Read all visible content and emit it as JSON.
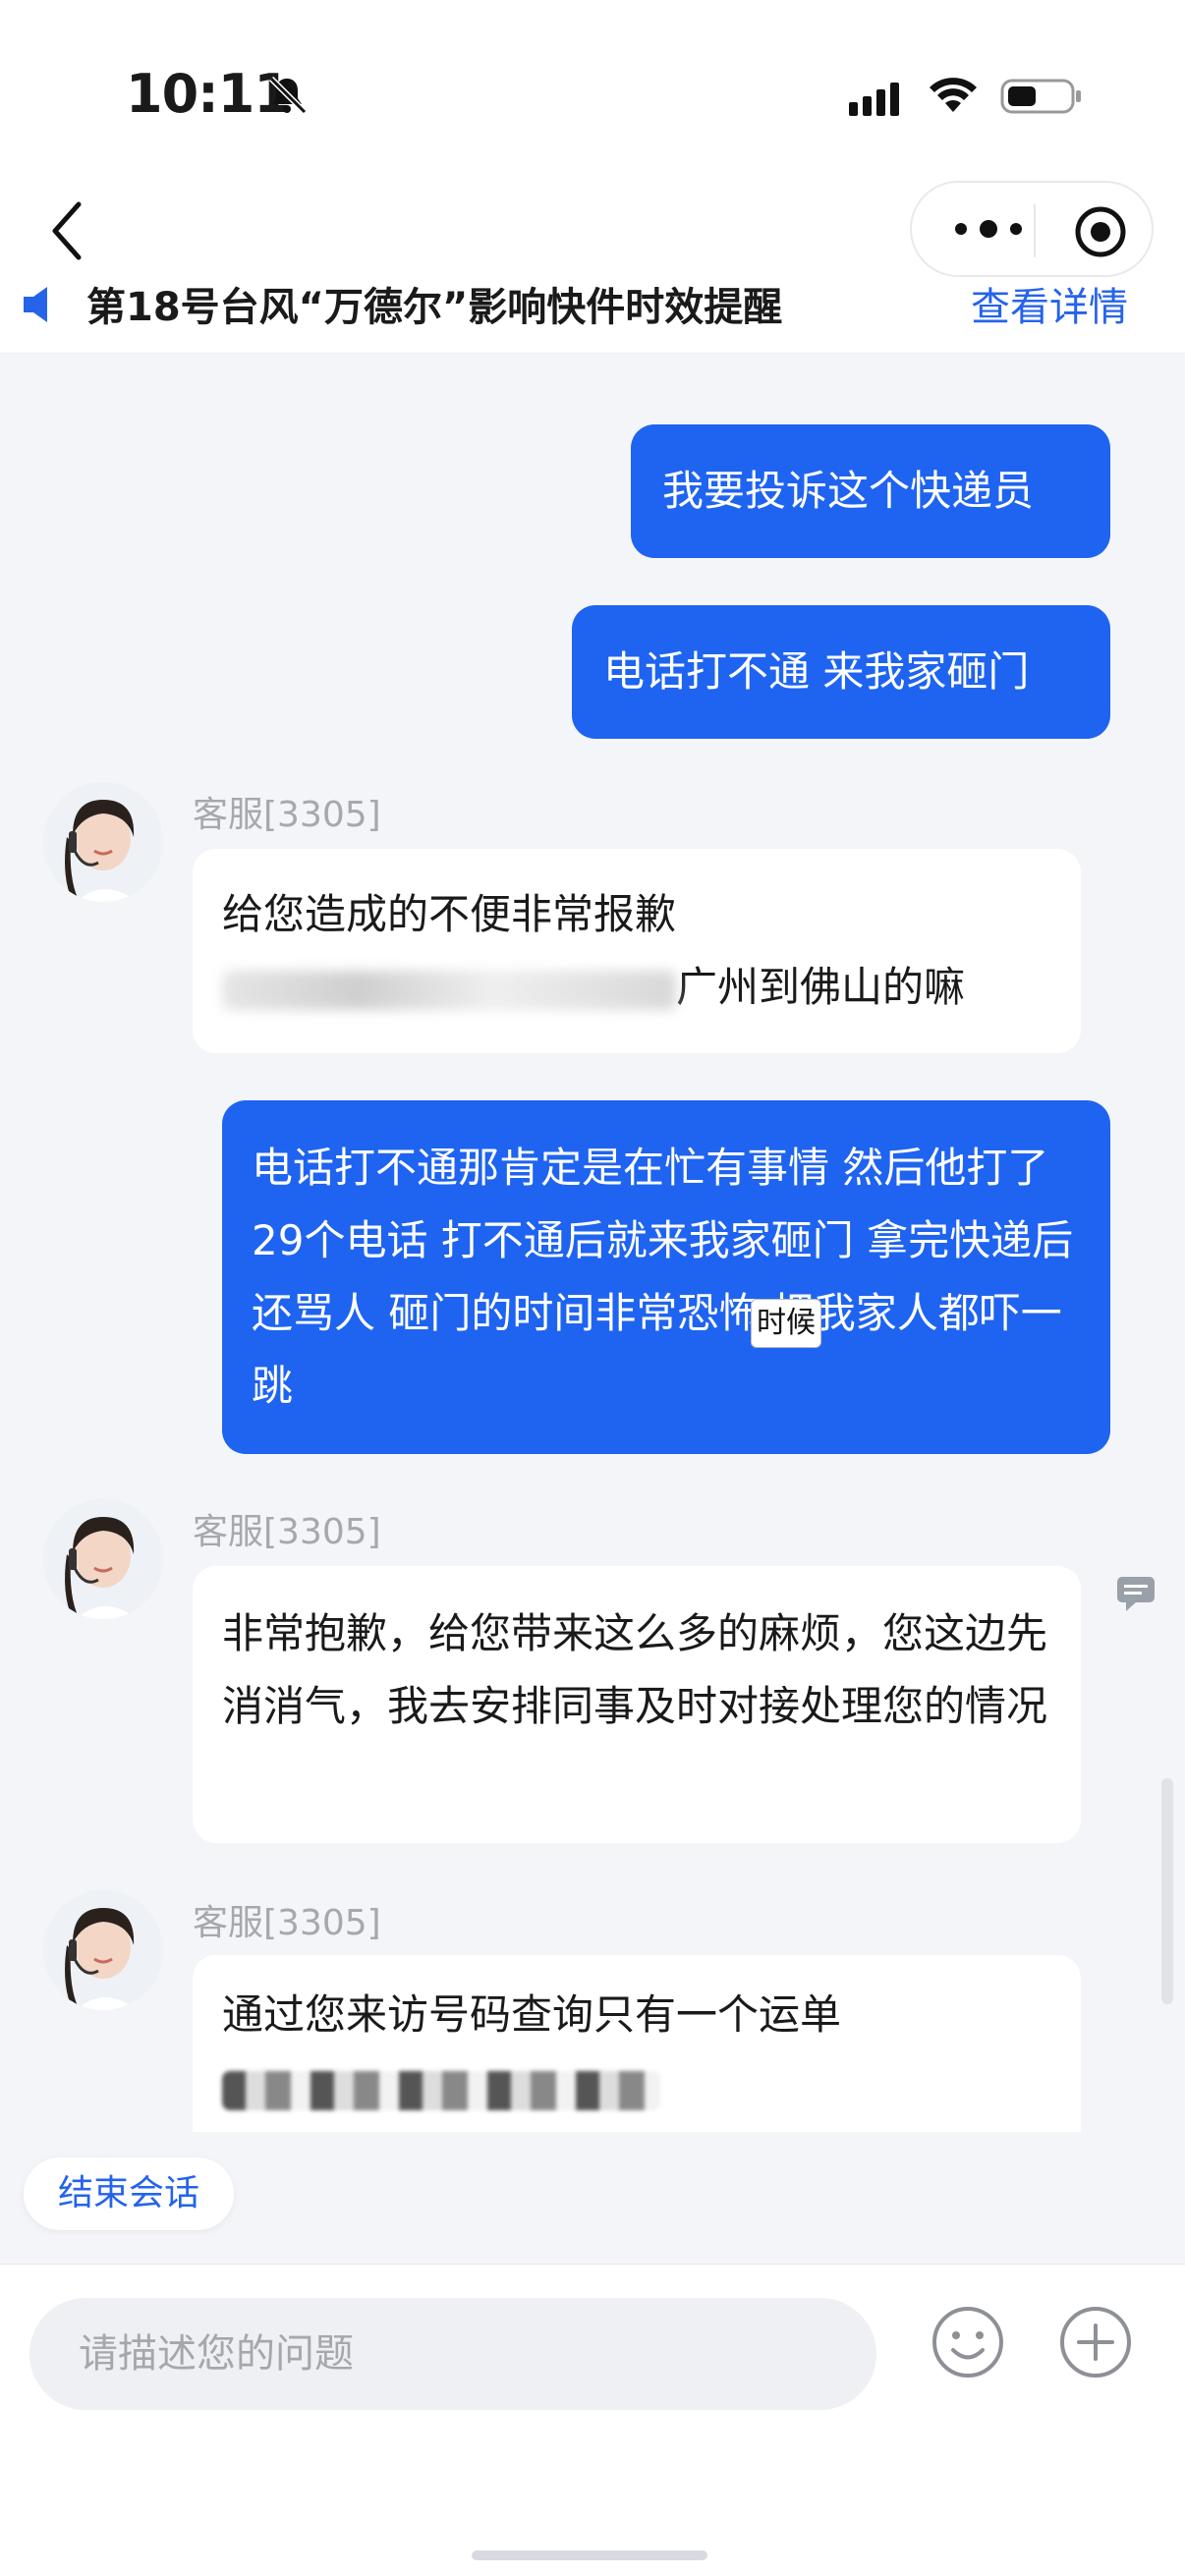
{
  "status_bar": {
    "time": "10:11"
  },
  "notice_bar": {
    "text": "第18号台风“万德尔”影响快件时效提醒",
    "link": "查看详情"
  },
  "messages": {
    "m1": "我要投诉这个快递员",
    "m2": "电话打不通 来我家砸门",
    "m3": "电话打不通那肯定是在忙有事情 然后他打了29个电话 打不通后就来我家砸门 拿完快递后还骂人 砸门的时间非常恐怖 把我家人都吓一跳"
  },
  "agent_label": "客服[3305]",
  "agent_messages": {
    "a1_line1": "给您造成的不便非常报歉",
    "a1_line2": "广州到佛山的嘛",
    "a2": "非常抱歉，给您带来这么多的麻烦，您这边先消消气，我去安排同事及时对接处理您的情况",
    "a3_line1": "通过您来访号码查询只有一个运单"
  },
  "tooltip": "时候",
  "end_session_button": "结束会话",
  "composer": {
    "placeholder": "请描述您的问题"
  },
  "colors": {
    "primary": "#1f64f0",
    "link": "#2563eb",
    "background": "#f4f5f9"
  }
}
